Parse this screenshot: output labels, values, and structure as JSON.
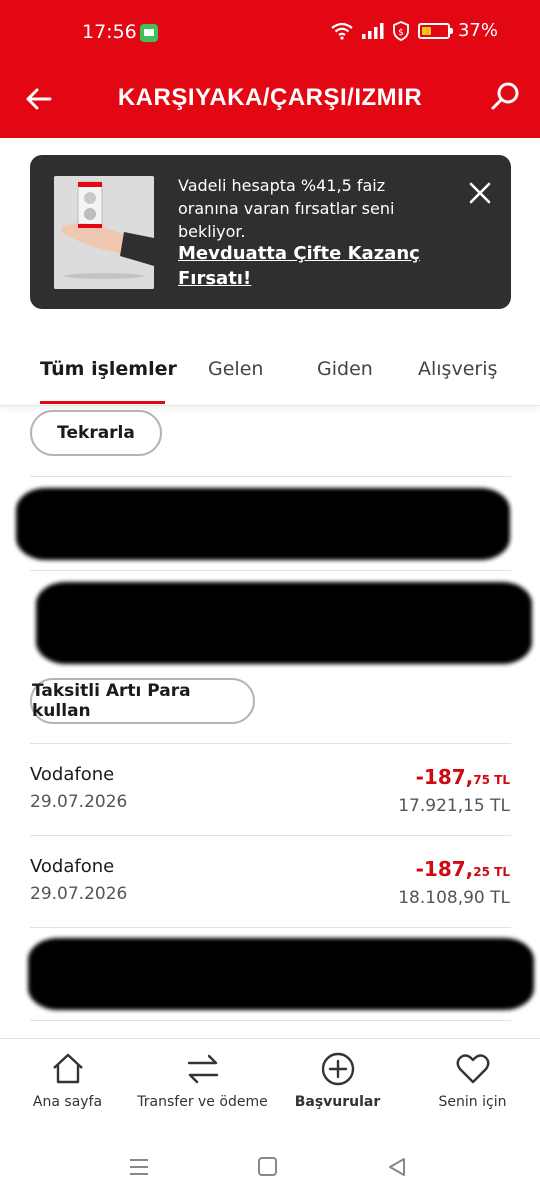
{
  "status_bar": {
    "time": "17:56",
    "battery_percent_label": "37%",
    "battery_level": 0.37,
    "icons": [
      "message-icon",
      "wifi-icon",
      "signal-icon",
      "shield-icon",
      "battery-icon"
    ]
  },
  "header": {
    "title": "KARŞIYAKA/ÇARŞI/IZMIR",
    "back_icon": "arrow-left-icon",
    "search_icon": "search-icon",
    "color": "#e30613"
  },
  "promo": {
    "text": "Vadeli hesapta %41,5 faiz oranına varan fırsatlar seni bekliyor.",
    "link": "Mevduatta Çifte Kazanç Fırsatı!",
    "close_icon": "close-icon"
  },
  "tabs": [
    {
      "label": "Tüm işlemler",
      "active": true
    },
    {
      "label": "Gelen",
      "active": false
    },
    {
      "label": "Giden",
      "active": false
    },
    {
      "label": "Alışveriş",
      "active": false
    }
  ],
  "actions": {
    "repeat": "Tekrarla",
    "installment": "Taksitli Artı Para kullan"
  },
  "transactions": [
    {
      "name": "Vodafone",
      "date": "29.07.2026",
      "amount_main": "-187,",
      "amount_decimal": "75 TL",
      "balance": "17.921,15 TL"
    },
    {
      "name": "Vodafone",
      "date": "29.07.2026",
      "amount_main": "-187,",
      "amount_decimal": "25 TL",
      "balance": "18.108,90 TL"
    }
  ],
  "bottom_nav": [
    {
      "label": "Ana sayfa",
      "icon": "home-icon",
      "active": false
    },
    {
      "label": "Transfer ve ödeme",
      "icon": "transfer-icon",
      "active": false
    },
    {
      "label": "Başvurular",
      "icon": "plus-circle-icon",
      "active": true
    },
    {
      "label": "Senin için",
      "icon": "heart-icon",
      "active": false
    }
  ],
  "system_nav": [
    "menu-icon",
    "home-square-icon",
    "back-triangle-icon"
  ],
  "colors": {
    "brand_red": "#e30613",
    "amount_red": "#d10a11",
    "banner_bg": "#2f2f31"
  }
}
